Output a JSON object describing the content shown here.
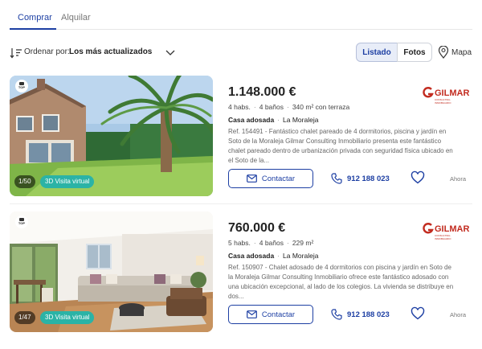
{
  "tabs": [
    {
      "label": "Comprar",
      "active": true
    },
    {
      "label": "Alquilar",
      "active": false
    }
  ],
  "toolbar": {
    "sort_label": "Ordenar por:",
    "sort_value": "Los más actualizados",
    "view_listado": "Listado",
    "view_fotos": "Fotos",
    "map_label": "Mapa"
  },
  "colors": {
    "accent": "#1d3fa3",
    "virtual_badge": "#2bb3a6",
    "agency_brand": "#c22b1f"
  },
  "listings": [
    {
      "photo_counter": "1/50",
      "virtual_tour": "3D Visita virtual",
      "top_badge": "TOP",
      "price": "1.148.000 €",
      "features": [
        "4 habs.",
        "4 baños",
        "340 m²  con terraza"
      ],
      "type": "Casa adosada",
      "location": "La Moraleja",
      "description": "Ref. 154491 - Fantástico chalet pareado de 4 dormitorios, piscina y jardín en Soto de la Moraleja Gilmar Consulting Inmobiliario presenta este fantástico chalet pareado dentro de urbanización privada con seguridad física ubicado en el Soto de la...",
      "contact_label": "Contactar",
      "phone": "912 188 023",
      "time": "Ahora",
      "agency": {
        "name": "GILMAR",
        "tagline": "CONSULTING INMOBILIARIO",
        "icon": "gilmar-logo-icon"
      }
    },
    {
      "photo_counter": "1/47",
      "virtual_tour": "3D Visita virtual",
      "top_badge": "TOP",
      "price": "760.000 €",
      "features": [
        "5 habs.",
        "4 baños",
        "229 m²"
      ],
      "type": "Casa adosada",
      "location": "La Moraleja",
      "description": "Ref. 150907 - Chalet adosado de 4 dormitorios con piscina y jardín en Soto de la Moraleja Gilmar Consulting Inmobiliario ofrece este fantástico adosado con una ubicación excepcional, al lado de los colegios. La vivienda se distribuye en dos...",
      "contact_label": "Contactar",
      "phone": "912 188 023",
      "time": "Ahora",
      "agency": {
        "name": "GILMAR",
        "tagline": "CONSULTING INMOBILIARIO",
        "icon": "gilmar-logo-icon"
      }
    }
  ]
}
